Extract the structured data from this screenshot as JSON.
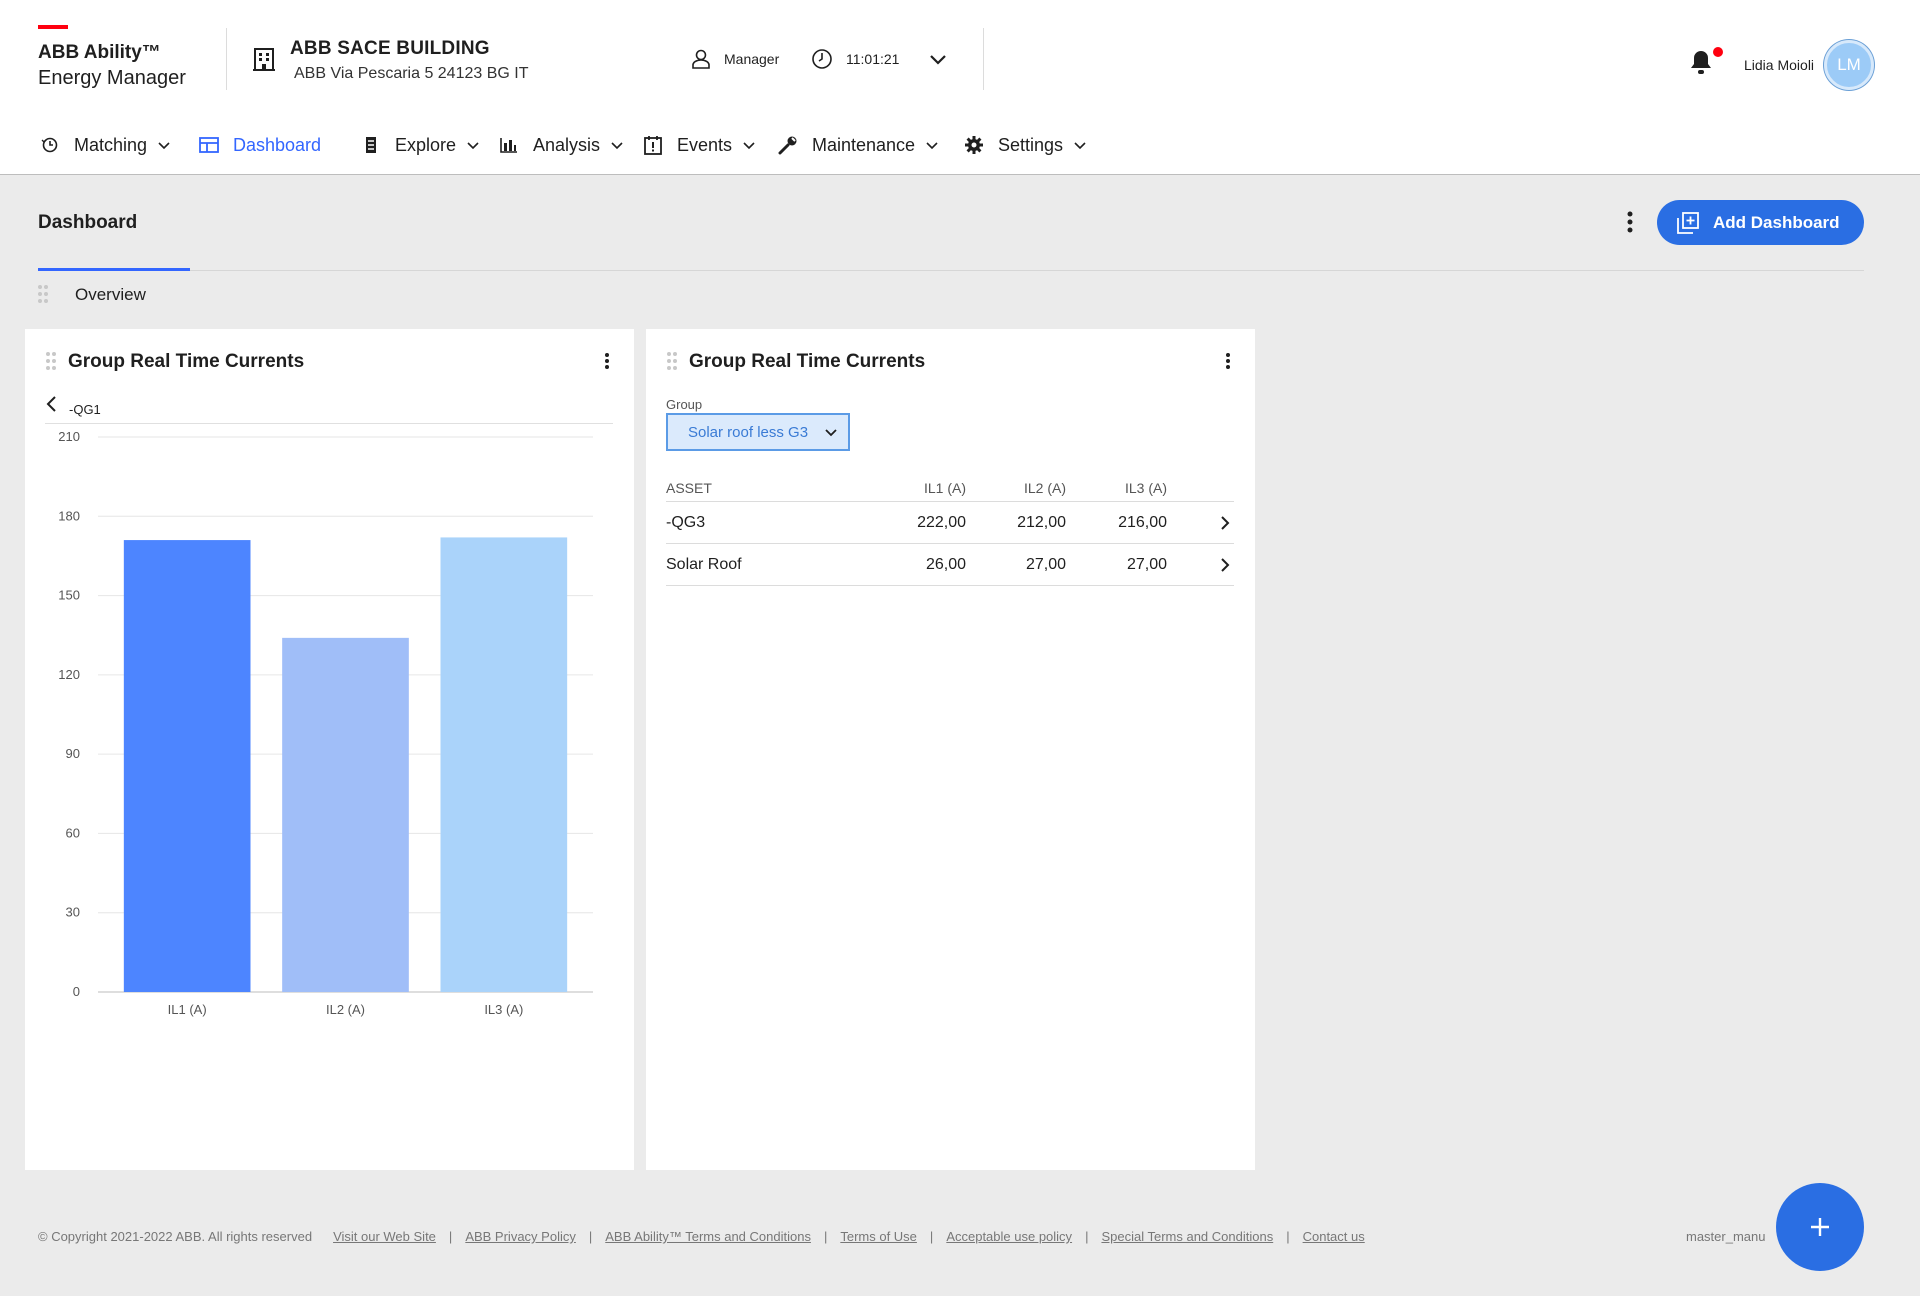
{
  "app": {
    "brand_line1": "ABB Ability™",
    "brand_line2": "Energy Manager",
    "accent_color": "#ff000f",
    "primary_color": "#2a6ee3"
  },
  "building": {
    "name": "ABB SACE BUILDING",
    "address": "ABB Via Pescaria 5 24123 BG IT",
    "icon": "building-icon"
  },
  "session": {
    "role": "Manager",
    "time": "11:01:21",
    "user_name": "Lidia Moioli",
    "user_initials": "LM",
    "has_notification": true
  },
  "nav": {
    "items": [
      {
        "label": "Matching",
        "icon": "matching-icon"
      },
      {
        "label": "Dashboard",
        "icon": "dashboard-icon",
        "active": true
      },
      {
        "label": "Explore",
        "icon": "explore-icon"
      },
      {
        "label": "Analysis",
        "icon": "analysis-icon"
      },
      {
        "label": "Events",
        "icon": "events-icon"
      },
      {
        "label": "Maintenance",
        "icon": "wrench-icon"
      },
      {
        "label": "Settings",
        "icon": "gear-icon"
      }
    ]
  },
  "page": {
    "title": "Dashboard",
    "add_button_label": "Add Dashboard",
    "tabs": [
      {
        "label": "Overview",
        "active": true
      }
    ]
  },
  "widgets": [
    {
      "title": "Group Real Time Currents",
      "breadcrumb": "-QG1"
    },
    {
      "title": "Group Real Time Currents",
      "group_label": "Group",
      "group_value": "Solar roof less G3",
      "table": {
        "headers": [
          "ASSET",
          "IL1 (A)",
          "IL2 (A)",
          "IL3 (A)"
        ],
        "rows": [
          [
            "-QG3",
            "222,00",
            "212,00",
            "216,00"
          ],
          [
            "Solar Roof",
            "26,00",
            "27,00",
            "27,00"
          ]
        ]
      }
    }
  ],
  "chart_data": {
    "type": "bar",
    "categories": [
      "IL1 (A)",
      "IL2 (A)",
      "IL3 (A)"
    ],
    "values": [
      171,
      134,
      172
    ],
    "colors": [
      "#4d85ff",
      "#a0bef8",
      "#aad3fa"
    ],
    "ylim": [
      0,
      210
    ],
    "yticks": [
      0,
      30,
      60,
      90,
      120,
      150,
      180,
      210
    ],
    "grid": true
  },
  "footer": {
    "copyright": "© Copyright 2021-2022 ABB. All rights reserved",
    "links": [
      "Visit our Web Site",
      "ABB Privacy Policy",
      "ABB Ability™ Terms and Conditions",
      "Terms of Use",
      "Acceptable use policy",
      "Special Terms and Conditions",
      "Contact us"
    ],
    "version": "master_manu"
  }
}
